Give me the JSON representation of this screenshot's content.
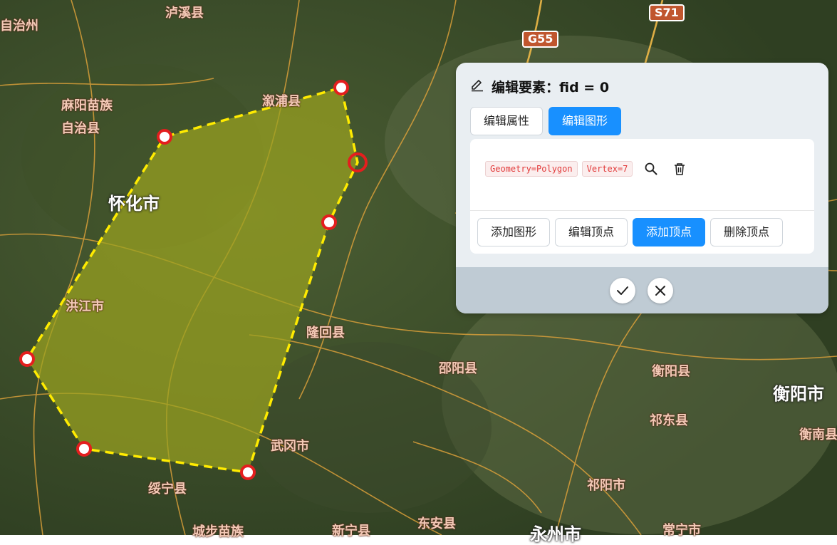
{
  "map": {
    "place_labels": [
      {
        "name": "泸溪县",
        "cls": ""
      },
      {
        "name": "自治州",
        "cls": ""
      },
      {
        "name": "麻阳苗族",
        "cls": ""
      },
      {
        "name": "自治县",
        "cls": ""
      },
      {
        "name": "溆浦县",
        "cls": ""
      },
      {
        "name": "怀化市",
        "cls": "big"
      },
      {
        "name": "洪江市",
        "cls": ""
      },
      {
        "name": "隆回县",
        "cls": ""
      },
      {
        "name": "邵阳县",
        "cls": ""
      },
      {
        "name": "衡阳县",
        "cls": ""
      },
      {
        "name": "衡阳市",
        "cls": "big"
      },
      {
        "name": "祁东县",
        "cls": ""
      },
      {
        "name": "武冈市",
        "cls": ""
      },
      {
        "name": "绥宁县",
        "cls": ""
      },
      {
        "name": "祁阳市",
        "cls": ""
      },
      {
        "name": "衡南县",
        "cls": ""
      },
      {
        "name": "城步苗族",
        "cls": ""
      },
      {
        "name": "新宁县",
        "cls": ""
      },
      {
        "name": "东安县",
        "cls": ""
      },
      {
        "name": "永州市",
        "cls": "big"
      },
      {
        "name": "常宁市",
        "cls": ""
      }
    ],
    "road_shields": [
      "S71",
      "G55"
    ],
    "polygon_fill": "#9aa220",
    "polygon_stroke": "#ffeb00",
    "vertex_color": "#e41e1e"
  },
  "panel": {
    "title": "编辑要素：fid = 0",
    "tabs": [
      {
        "label": "编辑属性",
        "active": false
      },
      {
        "label": "编辑图形",
        "active": true
      }
    ],
    "tags": [
      "Geometry=Polygon",
      "Vertex=7"
    ],
    "actions": [
      {
        "label": "添加图形",
        "active": false
      },
      {
        "label": "编辑顶点",
        "active": false
      },
      {
        "label": "添加顶点",
        "active": true
      },
      {
        "label": "删除顶点",
        "active": false
      }
    ],
    "accent_color": "#1890ff"
  }
}
